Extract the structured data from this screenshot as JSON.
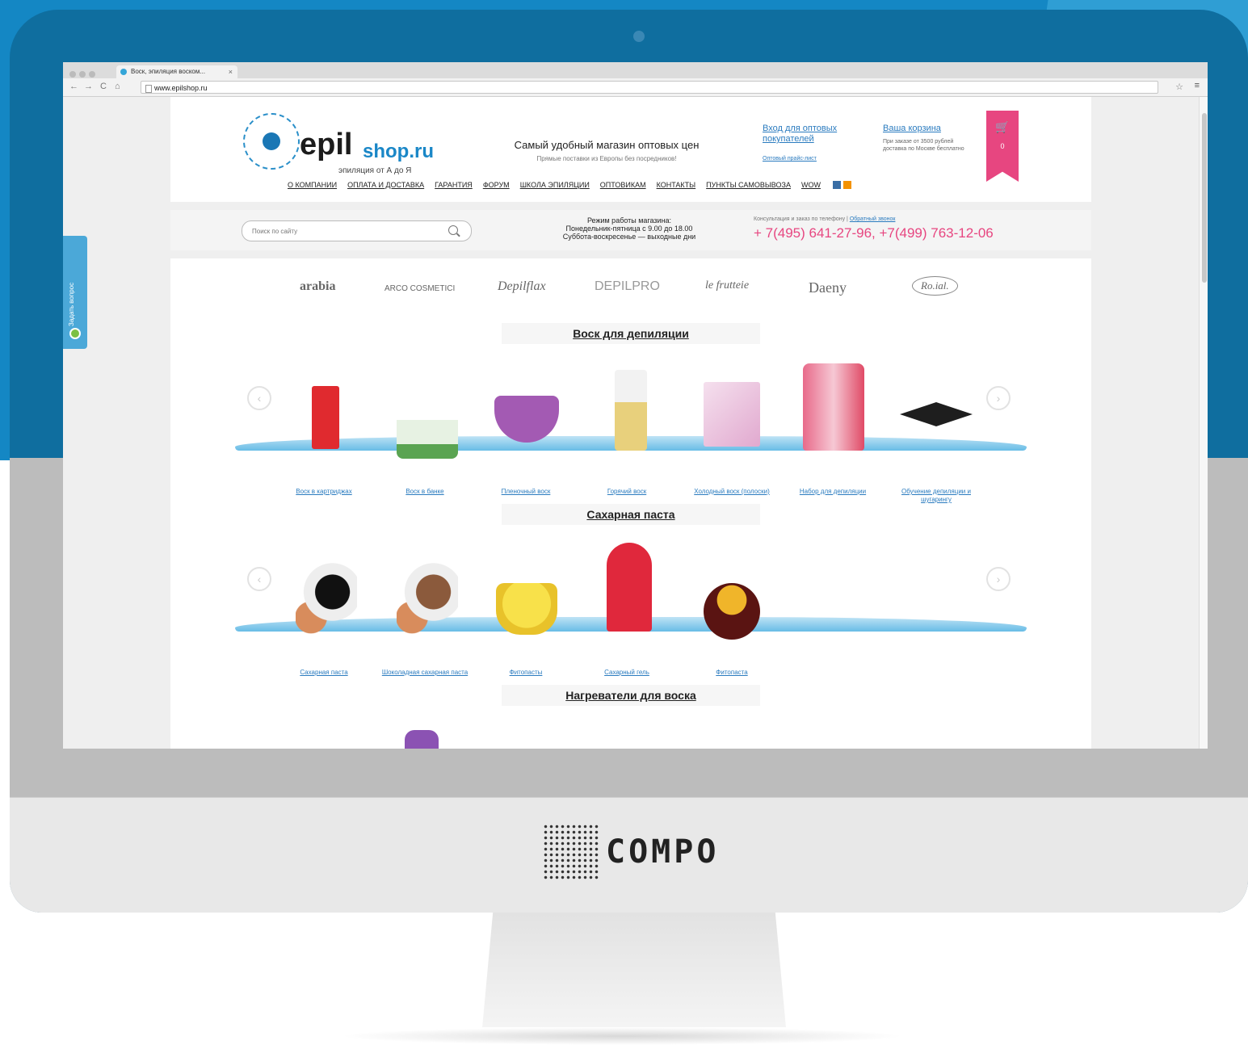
{
  "browser": {
    "tab_title": "Воск, эпиляция воском...",
    "tab_close": "×",
    "url": "www.epilshop.ru",
    "back": "←",
    "forward": "→",
    "reload": "C",
    "home": "⌂",
    "star": "☆",
    "menu": "≡"
  },
  "sidetab": {
    "label": "Задать вопрос"
  },
  "site": {
    "logo_main": "epil",
    "logo_domain": "shop.ru",
    "logo_tagline": "эпиляция от А до Я",
    "slogan": "Самый удобный магазин оптовых цен",
    "slogan_sub": "Прямые поставки из Европы без посредников!",
    "wholesale_login": "Вход для оптовых покупателей",
    "wholesale_price": "Оптовый прайс-лист",
    "cart_link": "Ваша корзина",
    "cart_note": "При заказе от 3500 рублей доставка по Москве бесплатно",
    "cart_count": "0",
    "nav": [
      "О КОМПАНИИ",
      "ОПЛАТА И ДОСТАВКА",
      "ГАРАНТИЯ",
      "ФОРУМ",
      "ШКОЛА ЭПИЛЯЦИИ",
      "ОПТОВИКАМ",
      "КОНТАКТЫ",
      "ПУНКТЫ САМОВЫВОЗА",
      "WOW"
    ]
  },
  "infobar": {
    "search_placeholder": "Поиск по сайту",
    "hours_title": "Режим работы магазина:",
    "hours_weekdays": "Понедельник-пятница с 9.00 до 18.00",
    "hours_weekend": "Суббота-воскресенье — выходные дни",
    "consult": "Консультация и заказ по телефону |",
    "callback": "Обратный звонок",
    "phones": "+ 7(495) 641-27-96, +7(499) 763-12-06"
  },
  "brands": [
    "arabia",
    "ARCO COSMETICI",
    "Depilflax",
    "DEPILPRO",
    "le frutteie",
    "Daeny",
    "Ro.ial."
  ],
  "sections": [
    {
      "title": "Воск для депиляции",
      "products": [
        "Воск в картриджах",
        "Воск в банке",
        "Пленочный воск",
        "Горячий воск",
        "Холодный воск (полоски)",
        "Набор для депиляции",
        "Обучение депиляции и шугарингу"
      ]
    },
    {
      "title": "Сахарная паста",
      "products": [
        "Сахарная паста",
        "Шоколадная сахарная паста",
        "Фитопасты",
        "Сахарный гель",
        "Фитопаста"
      ]
    },
    {
      "title": "Нагреватели для воска",
      "products": []
    }
  ],
  "monitor": {
    "brand": "COMPO"
  },
  "colors": {
    "accent_blue": "#1487c4",
    "brand_pink": "#e74680",
    "shelf_blue": "#68bce6",
    "link_blue": "#2a7bbf"
  }
}
